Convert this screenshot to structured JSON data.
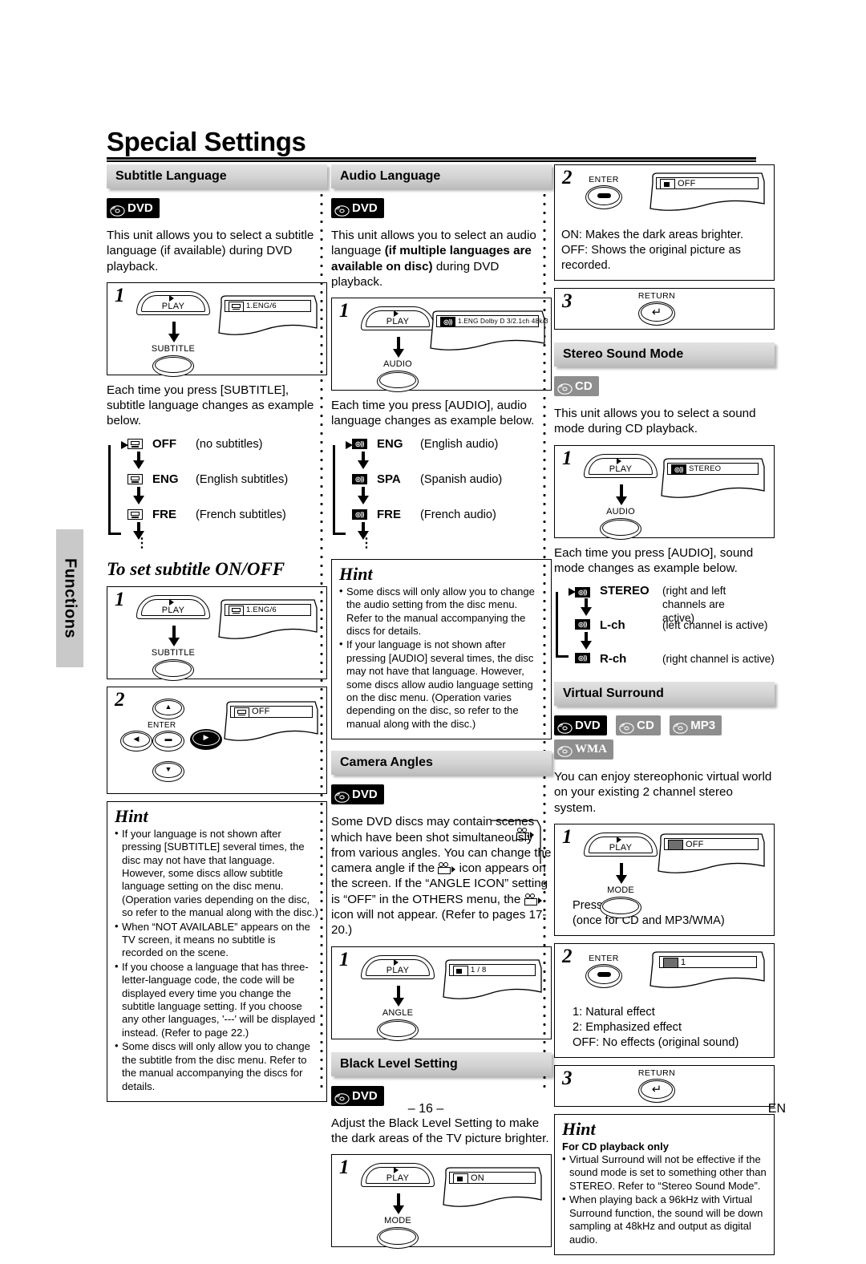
{
  "page": {
    "title": "Special Settings",
    "side_tab": "Functions",
    "page_number": "– 16 –",
    "language_code": "EN"
  },
  "sections": {
    "subtitle_language": {
      "heading": "Subtitle Language",
      "badges": [
        {
          "label": "DVD",
          "style": "dark"
        }
      ],
      "intro": "This unit allows you to select a subtitle language (if available) during DVD playback.",
      "step1": {
        "num": "1",
        "play_key": "PLAY",
        "action_key": "SUBTITLE",
        "osd_text": "1.ENG/6",
        "osd_icon": "subtitle-icon"
      },
      "after_text": "Each time you press [SUBTITLE], subtitle language changes as example below.",
      "flow": [
        {
          "icon": "subtitle-icon",
          "code": "OFF",
          "desc": "(no subtitles)"
        },
        {
          "icon": "subtitle-icon",
          "code": "ENG",
          "desc": "(English subtitles)"
        },
        {
          "icon": "subtitle-icon",
          "code": "FRE",
          "desc": "(French subtitles)"
        }
      ],
      "sub_heading": "To set subtitle ON/OFF",
      "sub_step1": {
        "num": "1",
        "play_key": "PLAY",
        "action_key": "SUBTITLE",
        "osd_text": "1.ENG/6"
      },
      "sub_step2": {
        "num": "2",
        "enter_label": "ENTER",
        "osd_text": "OFF"
      },
      "hint": {
        "title": "Hint",
        "items": [
          "If your language is not shown after pressing [SUBTITLE] several times, the disc may not have that language. However, some discs allow subtitle language setting on the disc menu. (Operation varies depending on the disc, so refer to the manual along with the disc.)",
          "When “NOT AVAILABLE” appears on the TV screen, it means no subtitle is recorded on the scene.",
          "If you choose a language that has three-letter-language code, the code will be displayed every time you change the subtitle language setting. If you choose any other languages, '---' will be displayed instead. (Refer to page 22.)",
          "Some discs will only allow you to change the subtitle from the disc menu. Refer to the manual accompanying the discs for details."
        ]
      }
    },
    "audio_language": {
      "heading": "Audio Language",
      "badges": [
        {
          "label": "DVD",
          "style": "dark"
        }
      ],
      "intro_pre": "This unit allows you to select an audio language ",
      "intro_bold": "(if multiple languages are available on disc)",
      "intro_post": " during DVD playback.",
      "step1": {
        "num": "1",
        "play_key": "PLAY",
        "action_key": "AUDIO",
        "osd_text": "1.ENG  Dolby D  3/2.1ch  48k/3",
        "osd_icon": "audio-icon"
      },
      "after_text": "Each time you press [AUDIO], audio language changes as example below.",
      "flow": [
        {
          "icon": "audio-icon",
          "code": "ENG",
          "desc": "(English audio)"
        },
        {
          "icon": "audio-icon",
          "code": "SPA",
          "desc": "(Spanish audio)"
        },
        {
          "icon": "audio-icon",
          "code": "FRE",
          "desc": "(French audio)"
        }
      ],
      "hint": {
        "title": "Hint",
        "items": [
          "Some discs will only allow you to change the audio setting from the disc menu. Refer to the manual accompanying the discs for details.",
          "If your language is not shown after pressing [AUDIO] several times, the disc may not have that language. However, some discs allow audio language setting on the disc menu. (Operation varies depending on the disc, so refer to the manual along with the disc.)"
        ]
      }
    },
    "camera_angles": {
      "heading": "Camera Angles",
      "badges": [
        {
          "label": "DVD",
          "style": "dark"
        }
      ],
      "intro_1": "Some DVD discs may contain scenes which have been shot simultaneously from various angles. You can change the camera angle if the ",
      "intro_2": " icon appears on the screen. If the “ANGLE ICON” setting is “OFF” in the OTHERS menu, the ",
      "intro_3": " icon will not appear. (Refer to pages 17-20.)",
      "step1": {
        "num": "1",
        "play_key": "PLAY",
        "action_key": "ANGLE",
        "osd_text": "1 / 8",
        "osd_icon": "angle-icon"
      }
    },
    "black_level": {
      "heading": "Black Level Setting",
      "badges": [
        {
          "label": "DVD",
          "style": "dark"
        }
      ],
      "intro": "Adjust the Black Level Setting to make the dark areas of the TV picture brighter.",
      "step1": {
        "num": "1",
        "play_key": "PLAY",
        "action_key": "MODE",
        "osd_text": "ON",
        "osd_icon": "black-level-icon"
      },
      "step2": {
        "num": "2",
        "enter_label": "ENTER",
        "osd_text": "OFF",
        "note_on": "ON:   Makes the dark areas brighter.",
        "note_off": "OFF: Shows the original picture as recorded."
      },
      "step3": {
        "num": "3",
        "return_label": "RETURN"
      }
    },
    "stereo_sound_mode": {
      "heading": "Stereo Sound Mode",
      "badges": [
        {
          "label": "CD",
          "style": "grey"
        }
      ],
      "intro": "This unit allows you to select a sound mode during CD playback.",
      "step1": {
        "num": "1",
        "play_key": "PLAY",
        "action_key": "AUDIO",
        "osd_text": "STEREO",
        "osd_icon": "audio-icon"
      },
      "after_text": "Each time you press [AUDIO], sound mode changes as example below.",
      "flow": [
        {
          "icon": "audio-icon",
          "code": "STEREO",
          "desc": "(right and left channels are active)"
        },
        {
          "icon": "audio-icon",
          "code": "L-ch",
          "desc": "(left channel is active)"
        },
        {
          "icon": "audio-icon",
          "code": "R-ch",
          "desc": "(right channel is active)"
        }
      ]
    },
    "virtual_surround": {
      "heading": "Virtual Surround",
      "badges": [
        {
          "label": "DVD",
          "style": "dark"
        },
        {
          "label": "CD",
          "style": "grey"
        },
        {
          "label": "MP3",
          "style": "grey"
        },
        {
          "label": "WMA",
          "style": "grey"
        }
      ],
      "intro": "You can enjoy stereophonic virtual world on your existing 2 channel stereo system.",
      "step1": {
        "num": "1",
        "play_key": "PLAY",
        "action_key": "MODE",
        "osd_text": "OFF",
        "osd_icon": "virtual-surround-icon",
        "note_1": "Press twice.",
        "note_2": "(once for CD and MP3/WMA)"
      },
      "step2": {
        "num": "2",
        "enter_label": "ENTER",
        "osd_text": "1",
        "note_1": "1: Natural effect",
        "note_2": "2: Emphasized effect",
        "note_3": "OFF: No effects (original sound)"
      },
      "step3": {
        "num": "3",
        "return_label": "RETURN"
      },
      "hint": {
        "title": "Hint",
        "subtitle": "For CD playback only",
        "items": [
          "Virtual Surround will not be effective if the sound mode is set to something other than STEREO. Refer to “Stereo Sound Mode”.",
          "When playing back a 96kHz with Virtual Surround function, the sound will be down sampling at 48kHz and output as digital audio."
        ]
      }
    }
  }
}
